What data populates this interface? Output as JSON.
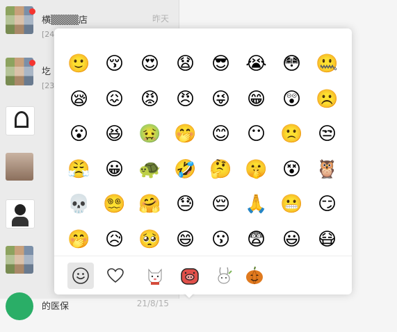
{
  "chat_list": [
    {
      "name": "横▒▒▒▒店",
      "preview": "[24",
      "time": "昨天",
      "unread": true,
      "avatar": "group-avatar"
    },
    {
      "name": "圪",
      "preview": "[23",
      "time": "",
      "unread": true,
      "avatar": "group-avatar"
    },
    {
      "name": "",
      "preview": "",
      "time": "",
      "unread": false,
      "avatar": "logo-avatar"
    },
    {
      "name": "",
      "preview": "",
      "time": "",
      "unread": false,
      "avatar": "photo-avatar"
    },
    {
      "name": "",
      "preview": "",
      "time": "",
      "unread": false,
      "avatar": "cartoon-avatar"
    },
    {
      "name": "",
      "preview": "",
      "time": "",
      "unread": false,
      "avatar": "group-avatar"
    },
    {
      "name": "的医保",
      "preview": "",
      "time": "21/8/15",
      "unread": false,
      "avatar": "green-avatar"
    }
  ],
  "emoji_grid": [
    [
      "🙂",
      "😚",
      "😍",
      "😧",
      "😎",
      "😭",
      "😳",
      "🤐"
    ],
    [
      "😪",
      "😖",
      "😡",
      "😠",
      "😜",
      "😁",
      "😲",
      "☹️"
    ],
    [
      "😮",
      "😆",
      "🤢",
      "🤭",
      "😊",
      "😶",
      "🙁",
      "😒"
    ],
    [
      "😤",
      "😀",
      "🐢",
      "🤣",
      "🤔",
      "🤫",
      "😵",
      "🦉"
    ],
    [
      "💀",
      "😵‍💫",
      "🤗",
      "😓",
      "😔",
      "🙏",
      "😬",
      "😏"
    ],
    [
      "🤭",
      "😥",
      "🥺",
      "😄",
      "😗",
      "😨",
      "😃",
      "😷"
    ]
  ],
  "emoji_names": [
    [
      "smile",
      "shy",
      "heart-eyes",
      "surprised",
      "cool",
      "crying",
      "blushing",
      "silenced"
    ],
    [
      "sleepy",
      "awkward",
      "angry",
      "furious",
      "tongue",
      "grin",
      "shocked",
      "frown"
    ],
    [
      "stunned",
      "laughing",
      "sick",
      "covering-mouth",
      "happy",
      "speechless",
      "sad",
      "bored"
    ],
    [
      "pouting",
      "big-grin",
      "turtle",
      "rofl",
      "thinking",
      "shh",
      "dizzy",
      "owl"
    ],
    [
      "skull",
      "dazed",
      "hug",
      "sweat",
      "pensive",
      "pray",
      "grimace",
      "smirk"
    ],
    [
      "giggle",
      "disappointed",
      "pleading",
      "beam",
      "kiss",
      "scared",
      "smiley",
      "masked"
    ]
  ],
  "tabs": [
    {
      "name": "emoji-tab",
      "active": true
    },
    {
      "name": "favorites-tab",
      "active": false
    },
    {
      "name": "cat-sticker-tab",
      "active": false
    },
    {
      "name": "pig-sticker-tab",
      "active": false
    },
    {
      "name": "rabbit-sticker-tab",
      "active": false
    },
    {
      "name": "pumpkin-sticker-tab",
      "active": false
    }
  ],
  "colors": {
    "panel_bg": "#ffffff",
    "active_tab_bg": "#e6e6e6",
    "unread_badge": "#f43530",
    "chat_list_bg": "#ebebeb"
  }
}
